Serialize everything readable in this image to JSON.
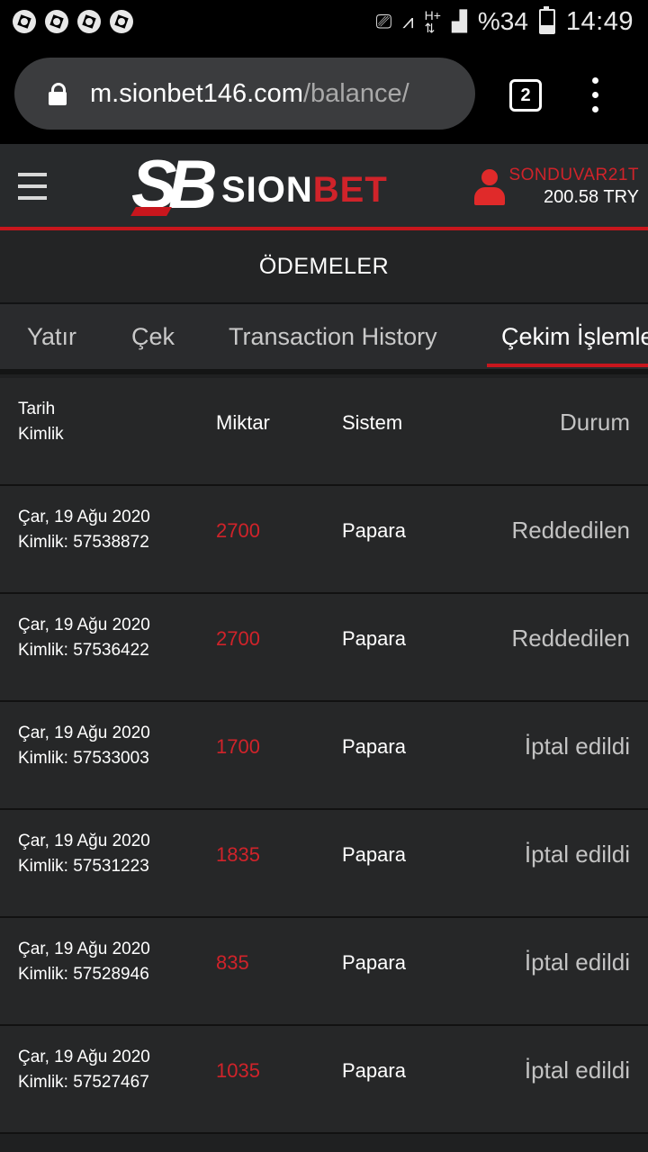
{
  "status_bar": {
    "notification_icons": [
      "aperture-icon",
      "aperture-icon",
      "aperture-icon",
      "aperture-icon"
    ],
    "battery_percent": "%34",
    "battery_level": 0.34,
    "time": "14:49"
  },
  "browser": {
    "url_host": "m.sionbet146.com",
    "url_path": "/balance/",
    "tab_count": "2"
  },
  "site": {
    "logo_sion": "SION",
    "logo_bet": "BET",
    "username": "SONDUVAR21T",
    "balance": "200.58 TRY"
  },
  "page": {
    "title": "ÖDEMELER"
  },
  "tabs": [
    {
      "label": "Yatır",
      "active": false
    },
    {
      "label": "Çek",
      "active": false
    },
    {
      "label": "Transaction History",
      "active": false
    },
    {
      "label": "Çekim İşlemleri",
      "active": true
    }
  ],
  "table": {
    "headers": {
      "date": "Tarih",
      "id": "Kimlik",
      "amount": "Miktar",
      "system": "Sistem",
      "status": "Durum"
    },
    "rows": [
      {
        "date": "Çar, 19 Ağu 2020",
        "id": "Kimlik: 57538872",
        "amount": "2700",
        "system": "Papara",
        "status": "Reddedilen"
      },
      {
        "date": "Çar, 19 Ağu 2020",
        "id": "Kimlik: 57536422",
        "amount": "2700",
        "system": "Papara",
        "status": "Reddedilen"
      },
      {
        "date": "Çar, 19 Ağu 2020",
        "id": "Kimlik: 57533003",
        "amount": "1700",
        "system": "Papara",
        "status": "İptal edildi"
      },
      {
        "date": "Çar, 19 Ağu 2020",
        "id": "Kimlik: 57531223",
        "amount": "1835",
        "system": "Papara",
        "status": "İptal edildi"
      },
      {
        "date": "Çar, 19 Ağu 2020",
        "id": "Kimlik: 57528946",
        "amount": "835",
        "system": "Papara",
        "status": "İptal edildi"
      },
      {
        "date": "Çar, 19 Ağu 2020",
        "id": "Kimlik: 57527467",
        "amount": "1035",
        "system": "Papara",
        "status": "İptal edildi"
      }
    ]
  },
  "colors": {
    "accent_red": "#c8161d",
    "amount_red": "#d0232a"
  }
}
